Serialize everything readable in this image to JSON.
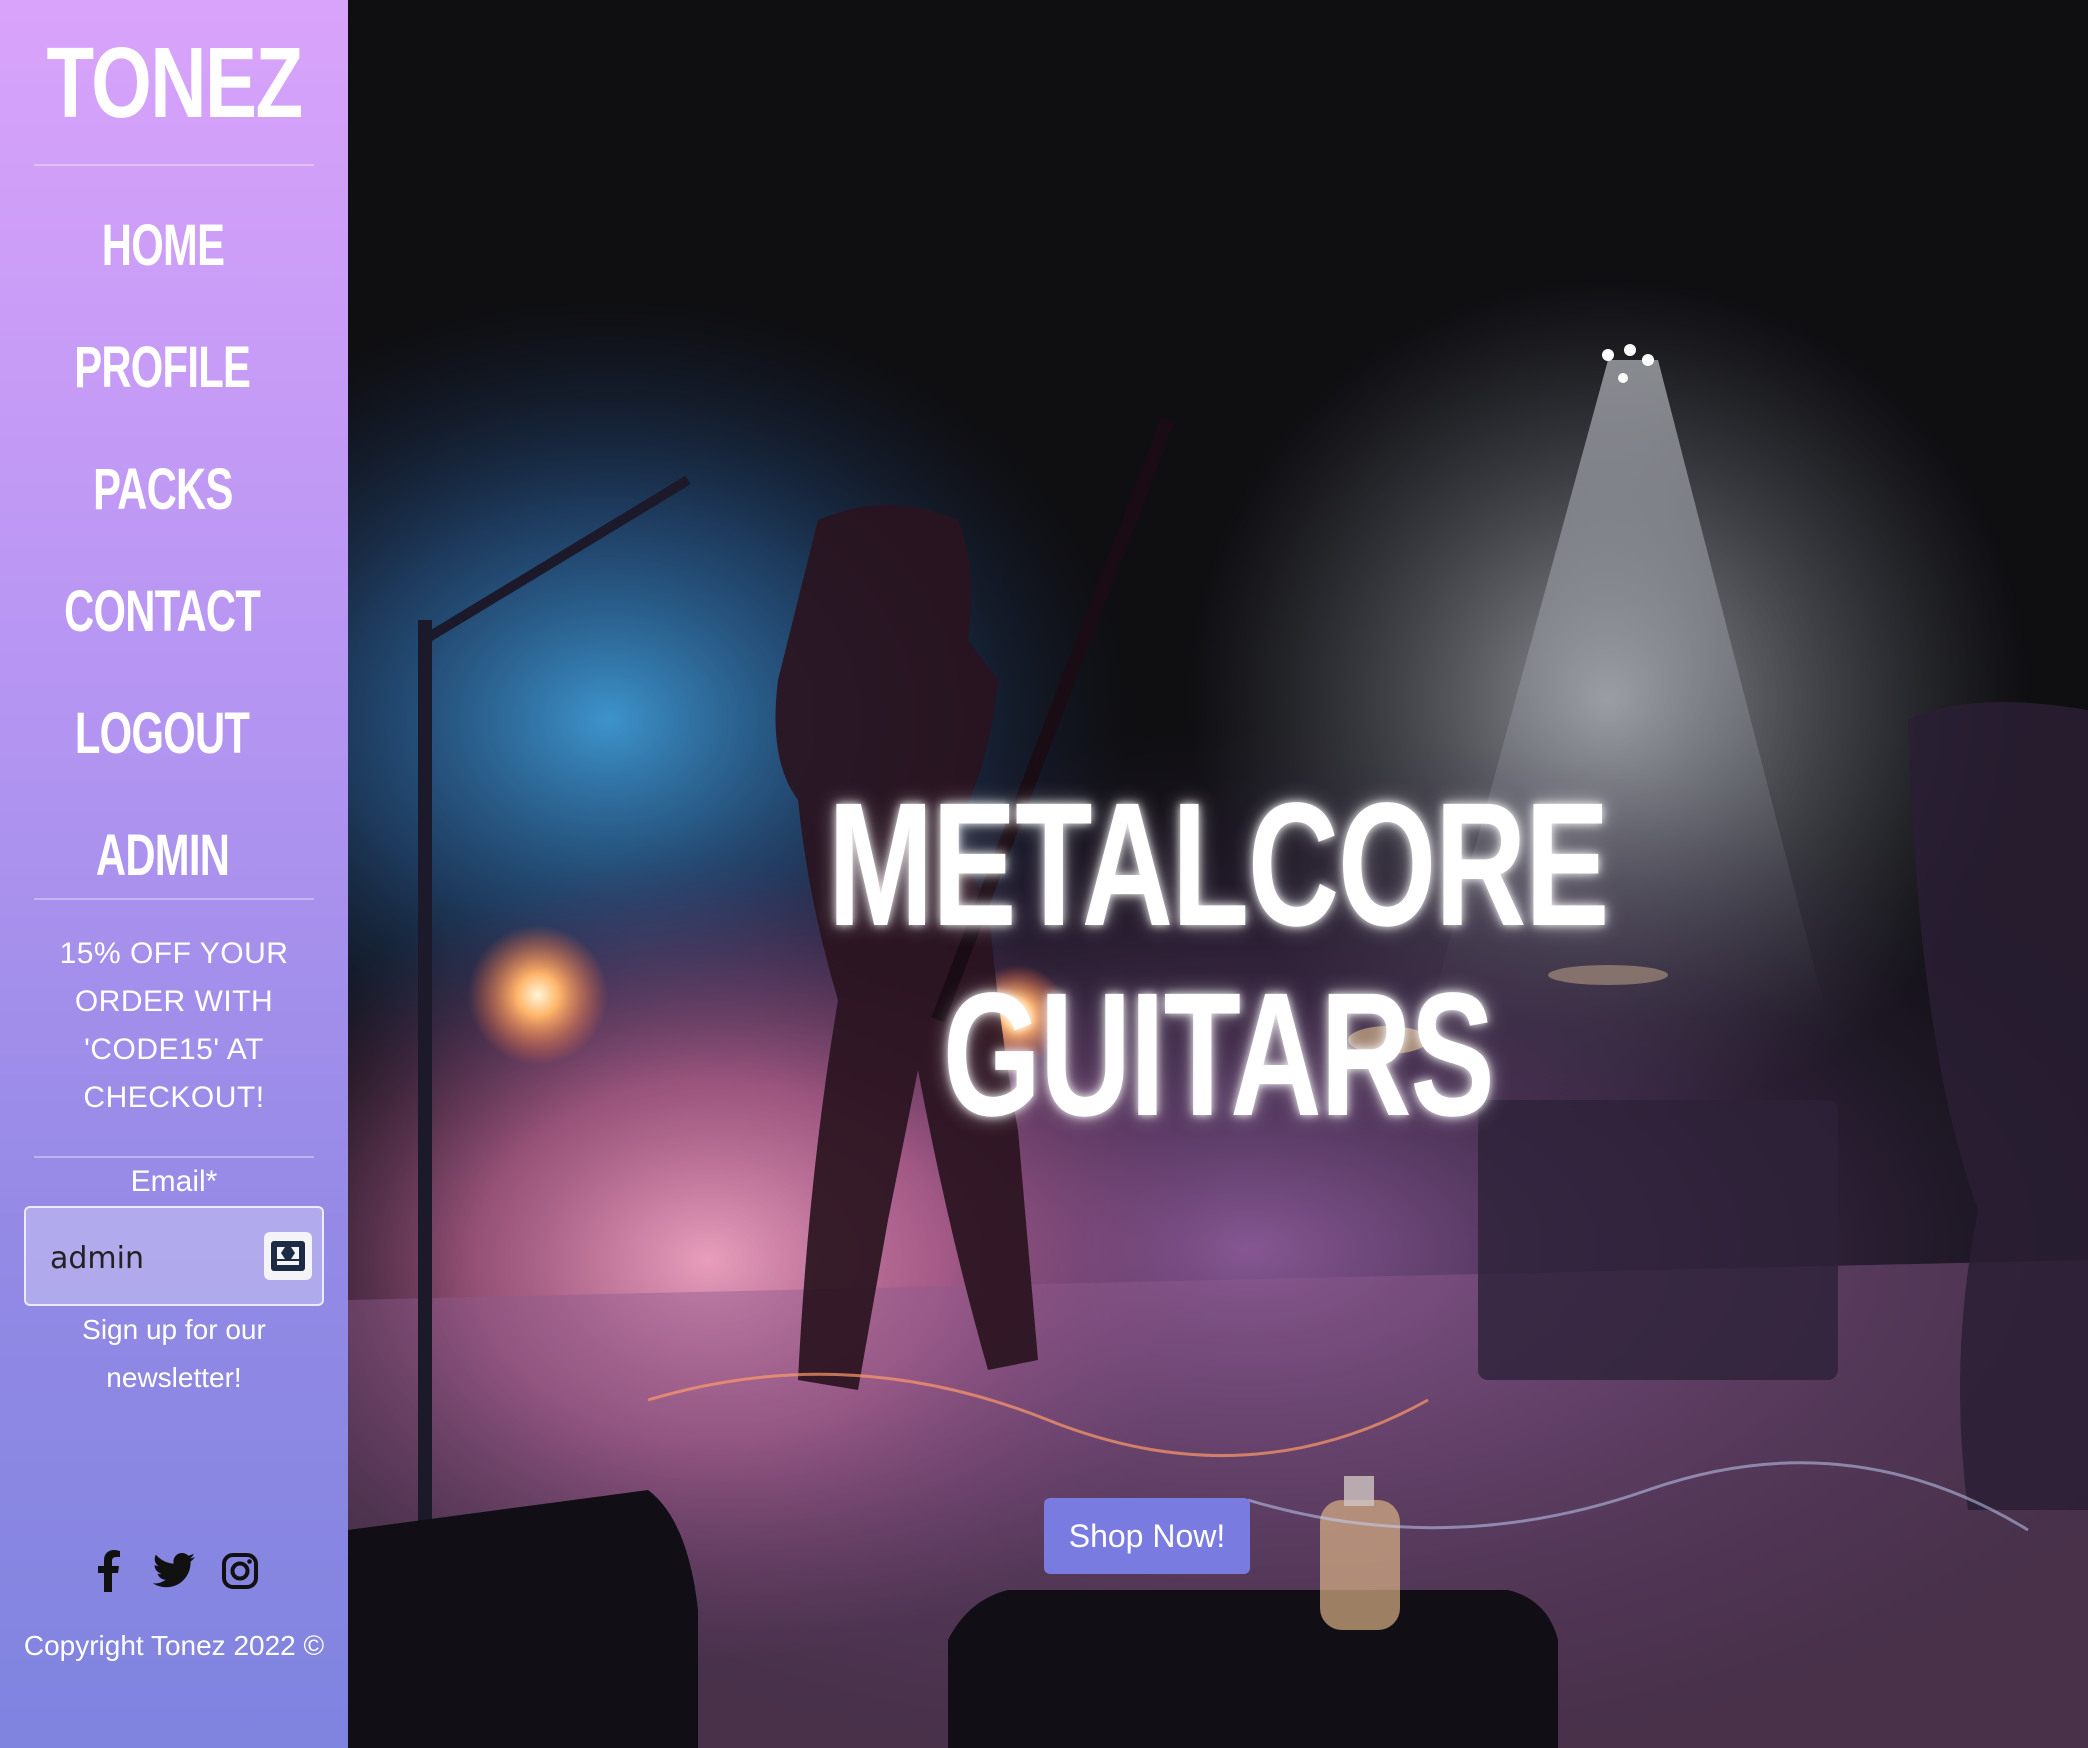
{
  "sidebar": {
    "logo": "TONEZ",
    "nav": [
      {
        "label": "HOME"
      },
      {
        "label": "PROFILE"
      },
      {
        "label": "PACKS"
      },
      {
        "label": "CONTACT"
      },
      {
        "label": "LOGOUT"
      },
      {
        "label": "ADMIN"
      }
    ],
    "promo": "15% OFF YOUR ORDER WITH 'CODE15' AT CHECKOUT!",
    "email_label": "Email*",
    "email_value": "admin",
    "newsletter": "Sign up for our newsletter!",
    "social_icons": [
      "facebook-icon",
      "twitter-icon",
      "instagram-icon"
    ],
    "copyright": "Copyright Tonez 2022 ©"
  },
  "hero": {
    "headline": "METALCORE GUITARS",
    "cta_label": "Shop Now!"
  },
  "colors": {
    "sidebar_top": "#d9a3fb",
    "sidebar_bottom": "#7f84df",
    "cta": "#7a7be0"
  }
}
